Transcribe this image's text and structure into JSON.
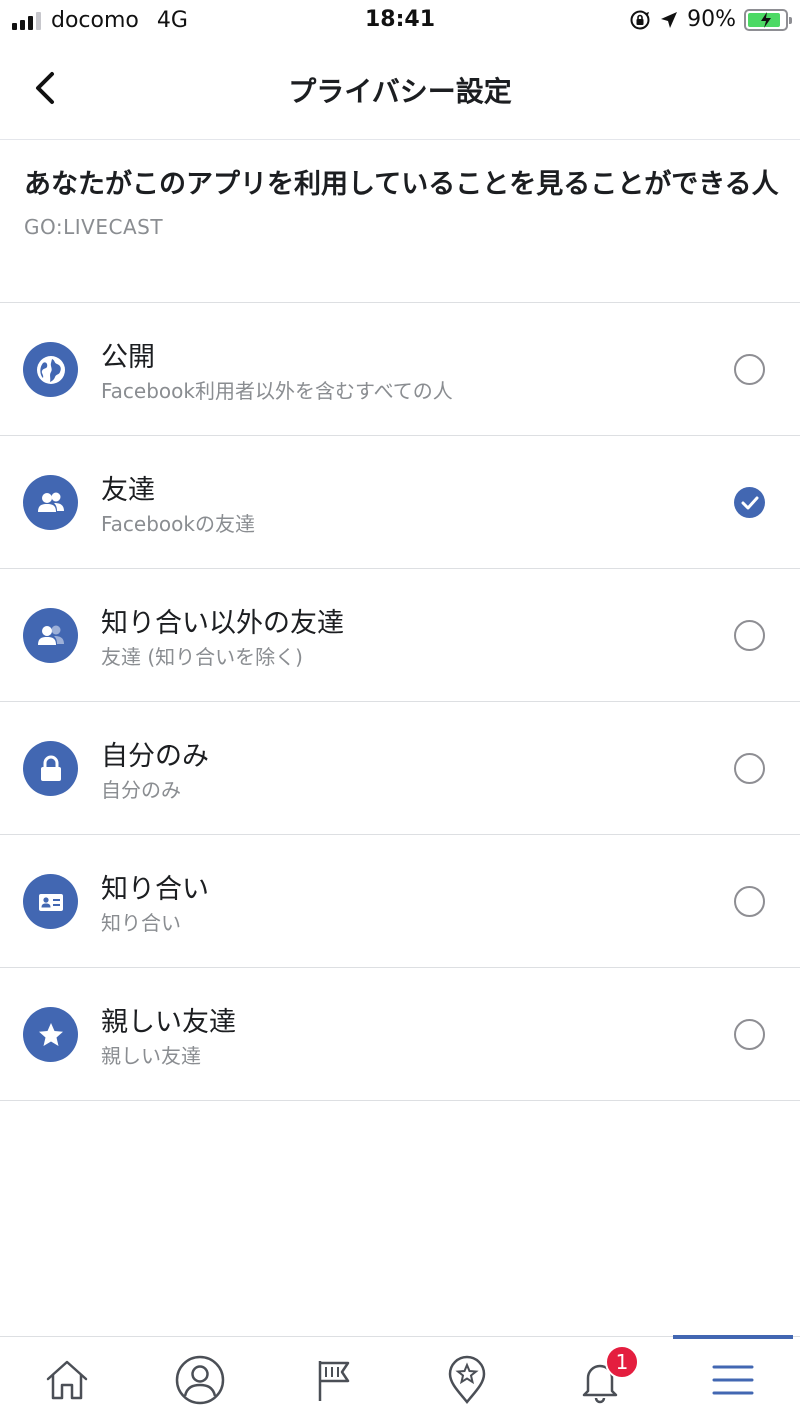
{
  "status_bar": {
    "carrier": "docomo",
    "network": "4G",
    "time": "18:41",
    "battery": "90%",
    "battery_level": 0.9,
    "icons": [
      "signal-icon",
      "rotation-lock-icon",
      "location-arrow-icon",
      "battery-charging-icon"
    ]
  },
  "nav": {
    "title": "プライバシー設定",
    "back_icon": "chevron-left-icon"
  },
  "section": {
    "title": "あなたがこのアプリを利用していることを見ることができる人",
    "app_name": "GO:LIVECAST"
  },
  "options": [
    {
      "label": "公開",
      "description": "Facebook利用者以外を含むすべての人",
      "icon": "globe-icon",
      "selected": false
    },
    {
      "label": "友達",
      "description": "Facebookの友達",
      "icon": "friends-icon",
      "selected": true
    },
    {
      "label": "知り合い以外の友達",
      "description": "友達 (知り合いを除く)",
      "icon": "friends-except-icon",
      "selected": false
    },
    {
      "label": "自分のみ",
      "description": "自分のみ",
      "icon": "lock-icon",
      "selected": false
    },
    {
      "label": "知り合い",
      "description": "知り合い",
      "icon": "id-card-icon",
      "selected": false
    },
    {
      "label": "親しい友達",
      "description": "親しい友達",
      "icon": "star-icon",
      "selected": false
    }
  ],
  "tab_bar": {
    "tabs": [
      {
        "icon": "home-icon",
        "active": false
      },
      {
        "icon": "profile-icon",
        "active": false
      },
      {
        "icon": "flag-icon",
        "active": false
      },
      {
        "icon": "places-star-icon",
        "active": false
      },
      {
        "icon": "bell-icon",
        "active": false,
        "badge": "1"
      },
      {
        "icon": "menu-icon",
        "active": true
      }
    ]
  },
  "colors": {
    "accent": "#4267b2",
    "badge": "#e41e3f",
    "secondary_text": "#8a8d91",
    "divider": "#dddfe2"
  }
}
